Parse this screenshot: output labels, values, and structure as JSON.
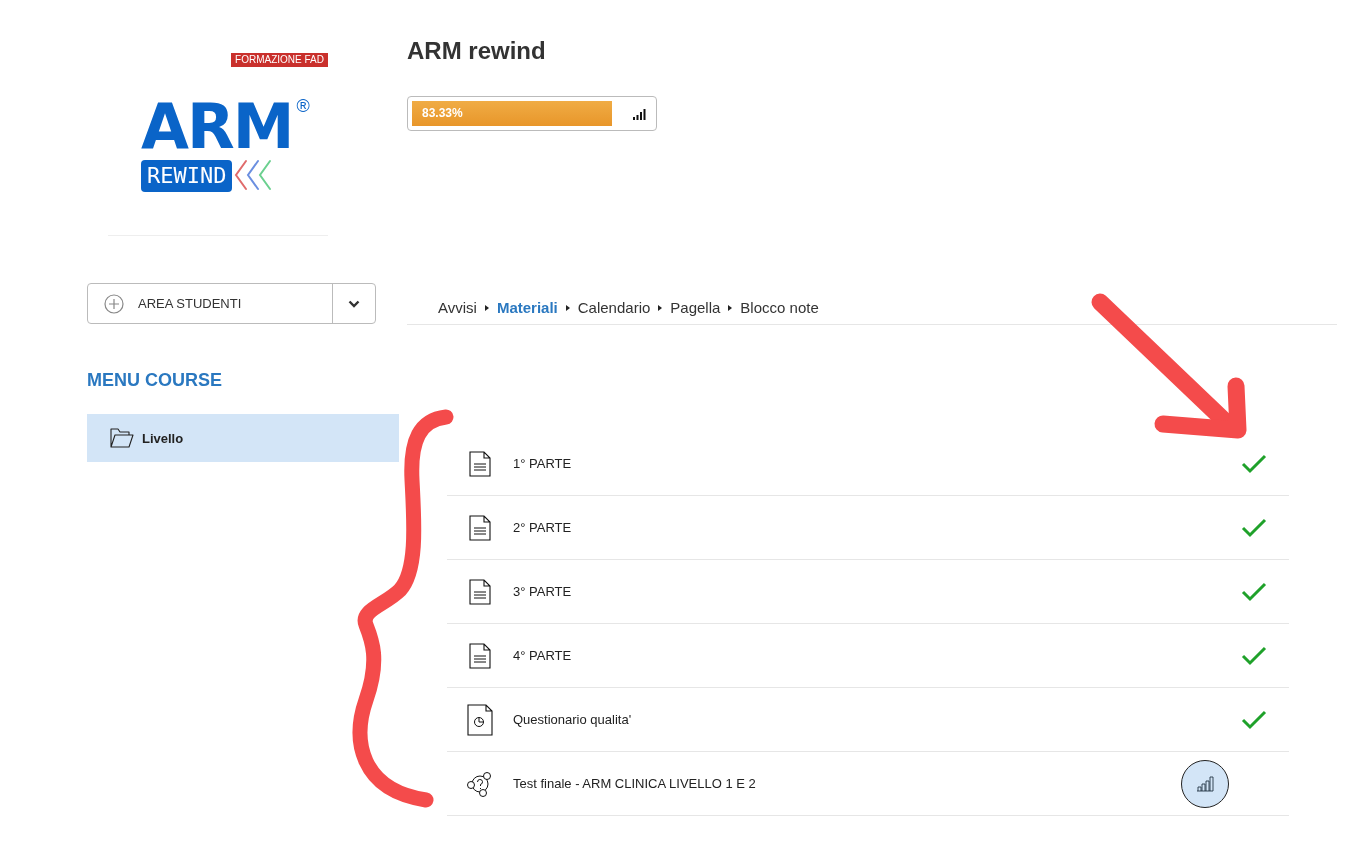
{
  "logo": {
    "badge": "FORMAZIONE FAD",
    "wordmark": "ARM",
    "registered": "®",
    "subtitle": "REWIND"
  },
  "course": {
    "title": "ARM rewind",
    "progress": {
      "level": 0.8333,
      "label": "83.33%"
    }
  },
  "area_dropdown": {
    "label": "AREA STUDENTI"
  },
  "nav": [
    {
      "label": "Avvisi",
      "selected": false
    },
    {
      "label": "Materiali",
      "selected": true
    },
    {
      "label": "Calendario",
      "selected": false
    },
    {
      "label": "Pagella",
      "selected": false
    },
    {
      "label": "Blocco note",
      "selected": false
    }
  ],
  "sidebar": {
    "title": "MENU COURSE",
    "items": [
      {
        "label": "Livello",
        "selected": true
      }
    ]
  },
  "materials": [
    {
      "kind": "document",
      "title": "1° PARTE",
      "completed": true
    },
    {
      "kind": "document",
      "title": "2° PARTE",
      "completed": true
    },
    {
      "kind": "document",
      "title": "3° PARTE",
      "completed": true
    },
    {
      "kind": "document",
      "title": "4° PARTE",
      "completed": true
    },
    {
      "kind": "survey",
      "title": "Questionario qualita'",
      "completed": true
    },
    {
      "kind": "test",
      "title": "Test finale - ARM CLINICA LIVELLO 1 E 2",
      "completed": false
    }
  ]
}
